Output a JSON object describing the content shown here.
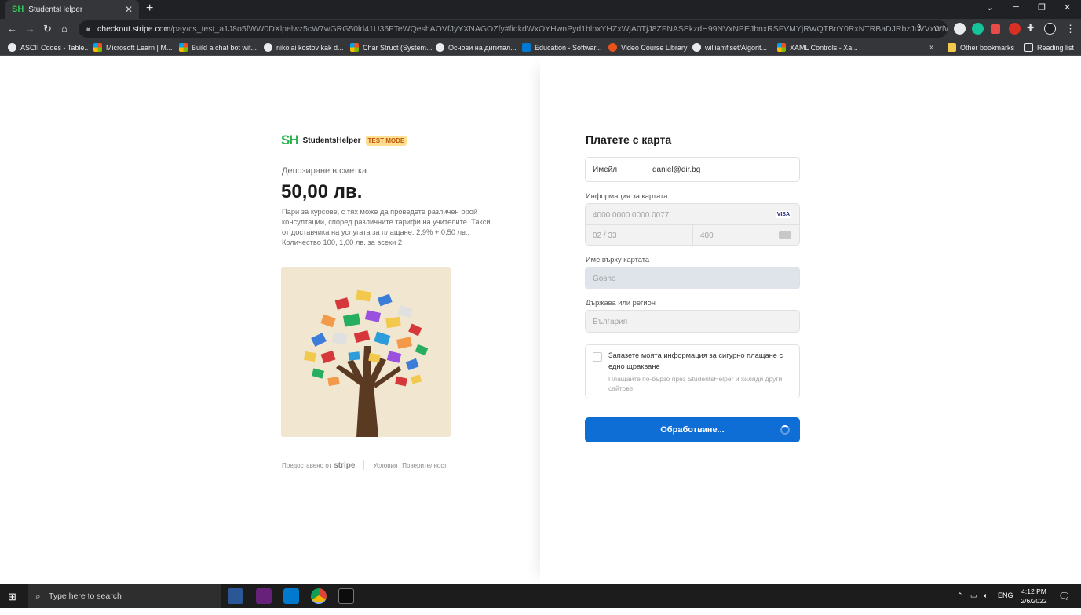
{
  "browser": {
    "tab_title": "StudentsHelper",
    "tab_favicon": "SH",
    "url_host": "checkout.stripe.com",
    "url_path": "/pay/cs_test_a1J8o5fWW0DXlpelwz5cW7wGRG50ld41U36FTeWQeshAOVfJyYXNAGOZfy#fidkdWxOYHwnPyd1blpxYHZxWjA0TjJ8ZFNASEkzdH99NVxNPEJbnxRSFVMYjRWQTBnY0RxNTRBaDJRbzJuVVxWfWRgdndlX...",
    "bookmarks": [
      "ASCII Codes - Table...",
      "Microsoft Learn | M...",
      "Build a chat bot wit...",
      "nikolai kostov kak d...",
      "Char Struct (System...",
      "Основи на дигитал...",
      "Education - Softwar...",
      "Video Course Library",
      "williamfiset/Algorit...",
      "XAML Controls - Xa..."
    ],
    "other_bookmarks": "Other bookmarks",
    "reading_list": "Reading list"
  },
  "merchant": {
    "logo_text": "SH",
    "name": "StudentsHelper",
    "badge": "TEST MODE"
  },
  "summary": {
    "product_name": "Депозиране в сметка",
    "price": "50,00 лв.",
    "description": "Пари за курсове, с тях може да проведете различен брой консултации, според различните тарифи на учителите. Такси от доставчика на услугата за плащане: 2,9% + 0,50 лв., Количество 100, 1,00 лв. за всеки 2",
    "footer_powered": "Предоставено от",
    "footer_brand": "stripe",
    "footer_terms": "Условия",
    "footer_privacy": "Поверителност"
  },
  "form": {
    "title": "Платете с карта",
    "email_label": "Имейл",
    "email_value": "daniel@dir.bg",
    "card_label": "Информация за картата",
    "card_number": "4000 0000 0000 0077",
    "card_brand": "VISA",
    "card_expiry": "02 / 33",
    "card_cvc": "400",
    "name_label": "Име върху картата",
    "name_value": "Gosho",
    "country_label": "Държава или регион",
    "country_value": "България",
    "save_title": "Запазете моята информация за сигурно плащане с едно щракване",
    "save_subtitle": "Плащайте по-бързо през StudentsHelper и хиляди други сайтове.",
    "pay_button": "Обработване..."
  },
  "taskbar": {
    "search_placeholder": "Type here to search",
    "lang": "ENG",
    "time": "4:12 PM",
    "date": "2/6/2022"
  },
  "colors": {
    "accent": "#0f6ed6",
    "brand_green": "#2bb24c",
    "test_badge_bg": "#ffde92"
  }
}
